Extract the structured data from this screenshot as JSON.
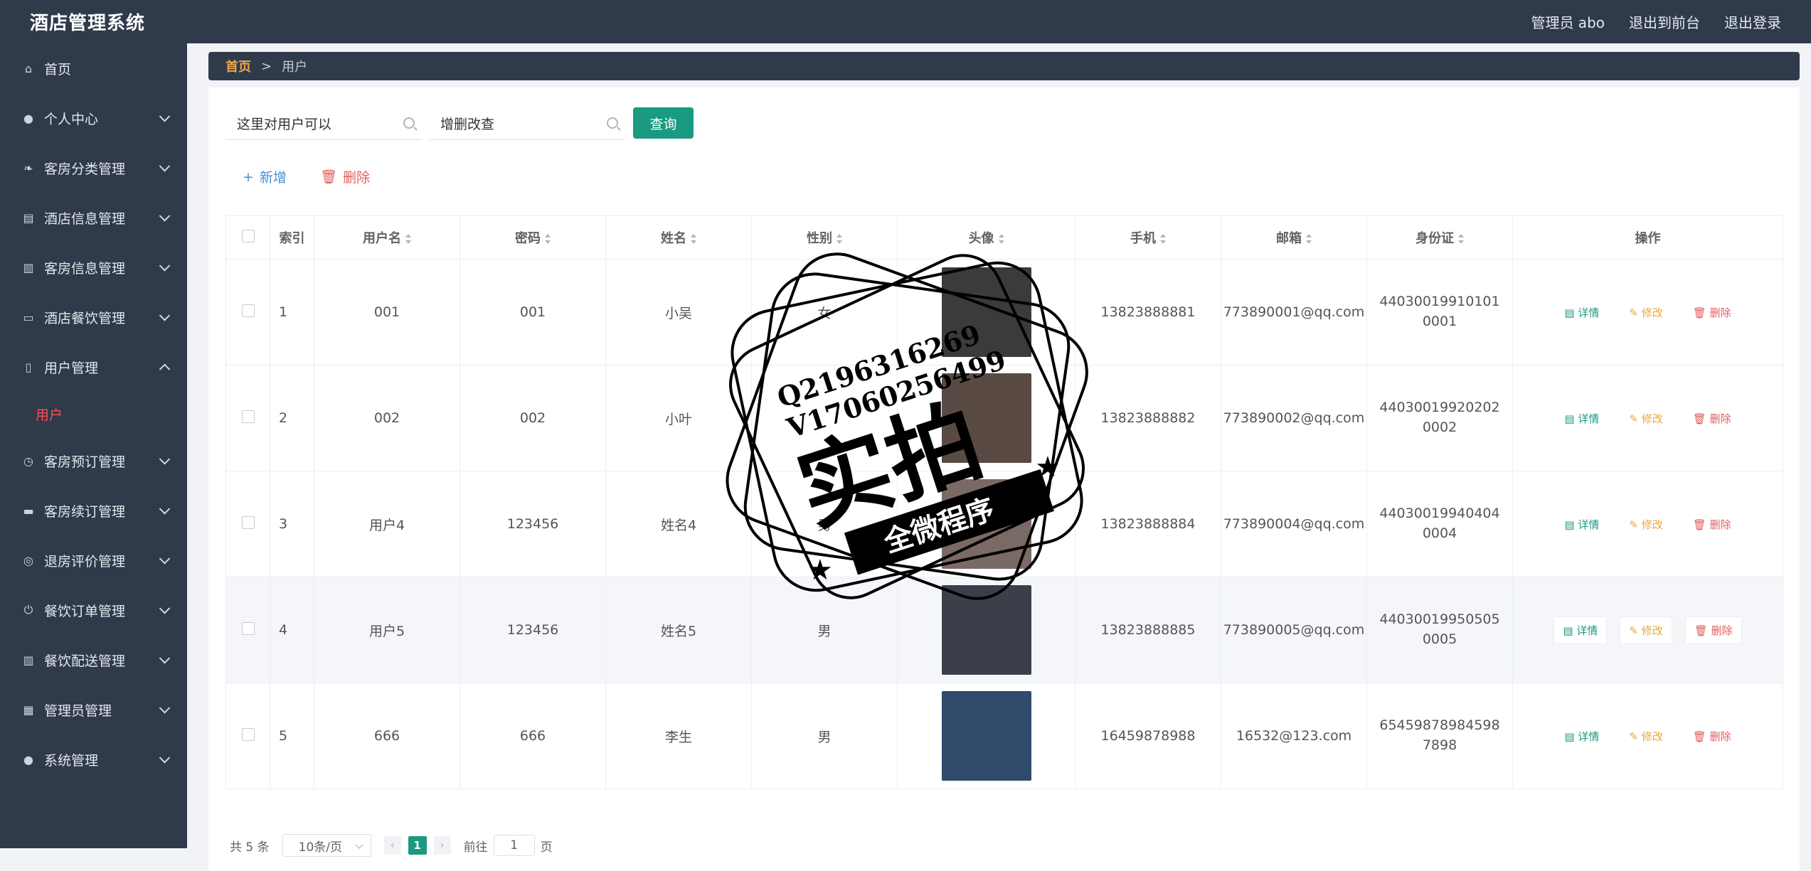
{
  "app": {
    "title": "酒店管理系统"
  },
  "topbar": {
    "admin": "管理员 abo",
    "back": "退出到前台",
    "logout": "退出登录"
  },
  "sidebar": {
    "items": [
      {
        "label": "首页",
        "icon": "home-icon",
        "expandable": false
      },
      {
        "label": "个人中心",
        "icon": "user-icon",
        "expandable": true
      },
      {
        "label": "客房分类管理",
        "icon": "leaf-icon",
        "expandable": true
      },
      {
        "label": "酒店信息管理",
        "icon": "clipboard-icon",
        "expandable": true
      },
      {
        "label": "客房信息管理",
        "icon": "bar-chart-icon",
        "expandable": true
      },
      {
        "label": "酒店餐饮管理",
        "icon": "chat-icon",
        "expandable": true
      },
      {
        "label": "用户管理",
        "icon": "phone-icon",
        "expandable": true,
        "open": true
      },
      {
        "label": "客房预订管理",
        "icon": "clock-icon",
        "expandable": true
      },
      {
        "label": "客房续订管理",
        "icon": "briefcase-icon",
        "expandable": true
      },
      {
        "label": "退房评价管理",
        "icon": "target-icon",
        "expandable": true
      },
      {
        "label": "餐饮订单管理",
        "icon": "power-icon",
        "expandable": true
      },
      {
        "label": "餐饮配送管理",
        "icon": "library-icon",
        "expandable": true
      },
      {
        "label": "管理员管理",
        "icon": "grid-icon",
        "expandable": true
      },
      {
        "label": "系统管理",
        "icon": "user-icon",
        "expandable": true
      }
    ],
    "submenu_active": "用户"
  },
  "breadcrumb": {
    "home": "首页",
    "sep": ">",
    "current": "用户"
  },
  "search": {
    "field1": "这里对用户可以",
    "field2": "增删改查",
    "query_label": "查询"
  },
  "actions": {
    "add_label": "新增",
    "delete_label": "删除"
  },
  "table": {
    "columns": [
      "索引",
      "用户名",
      "密码",
      "姓名",
      "性别",
      "头像",
      "手机",
      "邮箱",
      "身份证",
      "操作"
    ],
    "rows": [
      {
        "idx": "1",
        "username": "001",
        "password": "001",
        "name": "小吴",
        "gender": "女",
        "phone": "13823888881",
        "email": "773890001@qq.com",
        "idcard": "440300199101010001",
        "avatar_color": "#3b3b3b"
      },
      {
        "idx": "2",
        "username": "002",
        "password": "002",
        "name": "小叶",
        "gender": "",
        "phone": "13823888882",
        "email": "773890002@qq.com",
        "idcard": "440300199202020002",
        "avatar_color": "#5a4a44"
      },
      {
        "idx": "3",
        "username": "用户4",
        "password": "123456",
        "name": "姓名4",
        "gender": "男",
        "phone": "13823888884",
        "email": "773890004@qq.com",
        "idcard": "440300199404040004",
        "avatar_color": "#7a6a66"
      },
      {
        "idx": "4",
        "username": "用户5",
        "password": "123456",
        "name": "姓名5",
        "gender": "男",
        "phone": "13823888885",
        "email": "773890005@qq.com",
        "idcard": "440300199505050005",
        "avatar_color": "#3a3f4a"
      },
      {
        "idx": "5",
        "username": "666",
        "password": "666",
        "name": "李生",
        "gender": "男",
        "phone": "16459878988",
        "email": "16532@123.com",
        "idcard": "654598789845987898",
        "avatar_color": "#2f4a6a"
      }
    ],
    "op_labels": {
      "detail": "详情",
      "edit": "修改",
      "delete": "删除"
    }
  },
  "pagination": {
    "total": "共 5 条",
    "page_size": "10条/页",
    "current_page": "1",
    "goto_prefix": "前往",
    "goto_value": "1",
    "goto_suffix": "页"
  },
  "watermark": {
    "line1": "Q2196316269",
    "line2": "V17060256499",
    "big": "实拍",
    "ribbon": "全微程序"
  },
  "colors": {
    "sidebar": "#2f3a4b",
    "accent": "#1a9a80",
    "active_menu": "#ff4d4f",
    "breadcrumb_home": "#f0a64a"
  }
}
